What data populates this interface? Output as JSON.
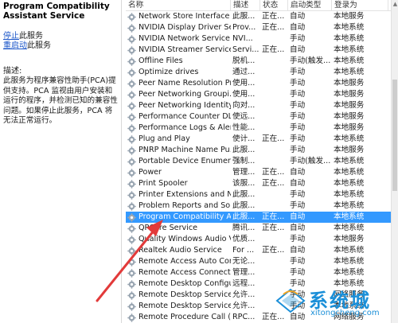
{
  "left": {
    "title": "Program Compatibility Assistant Service",
    "stop_link": "停止",
    "stop_suffix": "此服务",
    "restart_link": "重启动",
    "restart_suffix": "此服务",
    "desc_label": "描述:",
    "desc_text": "此服务为程序兼容性助手(PCA)提供支持。PCA 监视由用户安装和运行的程序，并检测已知的兼容性问题。如果停止此服务，PCA 将无法正常运行。"
  },
  "table": {
    "headers": {
      "name": "名称",
      "desc": "描述",
      "status": "状态",
      "start": "启动类型",
      "logon": "登录为"
    },
    "rows": [
      {
        "name": "Network Store Interface ...",
        "desc": "此服...",
        "status": "正在...",
        "start": "自动",
        "logon": "本地服务"
      },
      {
        "name": "NVIDIA Display Driver Se...",
        "desc": "Prov...",
        "status": "正在...",
        "start": "自动",
        "logon": "本地系统"
      },
      {
        "name": "NVIDIA Network Service",
        "desc": "NVI...",
        "status": "",
        "start": "手动",
        "logon": "本地系统"
      },
      {
        "name": "NVIDIA Streamer Service",
        "desc": "Servi...",
        "status": "正在...",
        "start": "自动",
        "logon": "本地系统"
      },
      {
        "name": "Offline Files",
        "desc": "脱机...",
        "status": "",
        "start": "手动(触发...",
        "logon": "本地系统"
      },
      {
        "name": "Optimize drives",
        "desc": "通过...",
        "status": "",
        "start": "手动",
        "logon": "本地系统"
      },
      {
        "name": "Peer Name Resolution Pr...",
        "desc": "使用...",
        "status": "",
        "start": "手动",
        "logon": "本地服务"
      },
      {
        "name": "Peer Networking Groupi...",
        "desc": "使用...",
        "status": "",
        "start": "手动",
        "logon": "本地服务"
      },
      {
        "name": "Peer Networking Identity...",
        "desc": "向对...",
        "status": "",
        "start": "手动",
        "logon": "本地服务"
      },
      {
        "name": "Performance Counter DL...",
        "desc": "使远...",
        "status": "",
        "start": "手动",
        "logon": "本地服务"
      },
      {
        "name": "Performance Logs & Aler...",
        "desc": "性能...",
        "status": "",
        "start": "手动",
        "logon": "本地服务"
      },
      {
        "name": "Plug and Play",
        "desc": "使计...",
        "status": "正在...",
        "start": "手动",
        "logon": "本地系统"
      },
      {
        "name": "PNRP Machine Name Pu...",
        "desc": "此服...",
        "status": "",
        "start": "手动",
        "logon": "本地服务"
      },
      {
        "name": "Portable Device Enumera...",
        "desc": "强制...",
        "status": "",
        "start": "手动(触发...",
        "logon": "本地系统"
      },
      {
        "name": "Power",
        "desc": "管理...",
        "status": "正在...",
        "start": "自动",
        "logon": "本地系统"
      },
      {
        "name": "Print Spooler",
        "desc": "该服...",
        "status": "正在...",
        "start": "自动",
        "logon": "本地系统"
      },
      {
        "name": "Printer Extensions and N...",
        "desc": "此服...",
        "status": "",
        "start": "手动",
        "logon": "本地系统"
      },
      {
        "name": "Problem Reports and Sol...",
        "desc": "此服...",
        "status": "",
        "start": "手动",
        "logon": "本地系统"
      },
      {
        "name": "Program Compatibility A...",
        "desc": "此服...",
        "status": "正在...",
        "start": "自动",
        "logon": "本地系统",
        "selected": true
      },
      {
        "name": "QPCore Service",
        "desc": "腾讯...",
        "status": "正在...",
        "start": "自动",
        "logon": "本地系统"
      },
      {
        "name": "Quality Windows Audio V...",
        "desc": "优质...",
        "status": "",
        "start": "手动",
        "logon": "本地服务"
      },
      {
        "name": "Realtek Audio Service",
        "desc": "For ...",
        "status": "正在...",
        "start": "自动",
        "logon": "本地系统"
      },
      {
        "name": "Remote Access Auto Con...",
        "desc": "无论...",
        "status": "",
        "start": "手动",
        "logon": "本地系统"
      },
      {
        "name": "Remote Access Connecti...",
        "desc": "管理...",
        "status": "",
        "start": "手动",
        "logon": "本地系统"
      },
      {
        "name": "Remote Desktop Configu...",
        "desc": "远程...",
        "status": "",
        "start": "手动",
        "logon": "本地系统"
      },
      {
        "name": "Remote Desktop Services",
        "desc": "允许...",
        "status": "",
        "start": "手动",
        "logon": "网络服务"
      },
      {
        "name": "Remote Desktop Service...",
        "desc": "允许...",
        "status": "",
        "start": "手动",
        "logon": "本地系统"
      },
      {
        "name": "Remote Procedure Call (...",
        "desc": "RPC...",
        "status": "正在...",
        "start": "自动",
        "logon": "网络服务"
      }
    ]
  },
  "watermark": {
    "cn": "系统城",
    "url": "xitongcheng.com"
  },
  "colors": {
    "selection": "#3399ff",
    "link": "#1a55c9",
    "arrow": "#e23a3a",
    "watermark": "#1b8fd8"
  }
}
